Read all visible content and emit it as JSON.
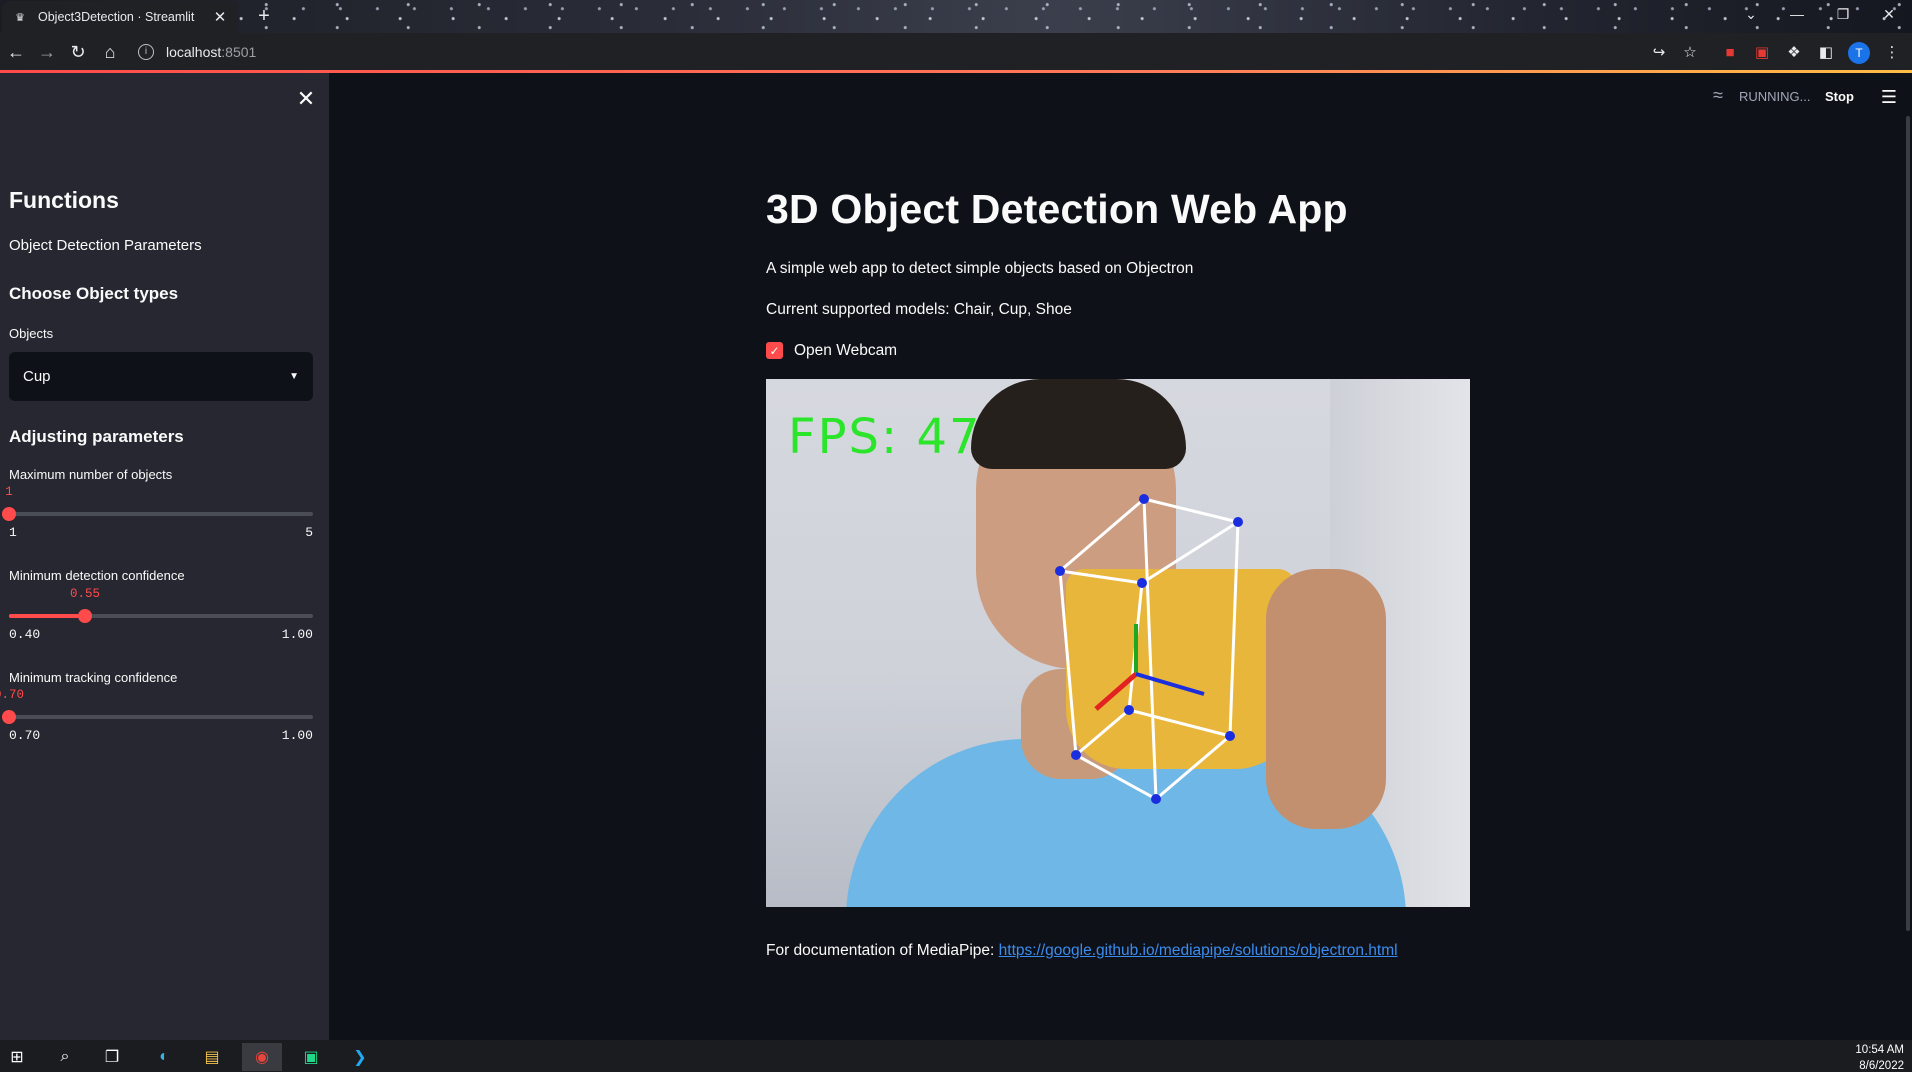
{
  "browser": {
    "tab_title": "Object3Detection · Streamlit",
    "url_host": "localhost",
    "url_port": ":8501",
    "profile_initial": "T"
  },
  "app": {
    "status": "RUNNING...",
    "stop_label": "Stop"
  },
  "sidebar": {
    "title": "Functions",
    "subtitle": "Object Detection Parameters",
    "section_objects": "Choose Object types",
    "objects_label": "Objects",
    "objects_value": "Cup",
    "section_params": "Adjusting parameters",
    "sliders": [
      {
        "label": "Maximum number of objects",
        "value": "1",
        "min": "1",
        "max": "5",
        "fraction": 0.0
      },
      {
        "label": "Minimum detection confidence",
        "value": "0.55",
        "min": "0.40",
        "max": "1.00",
        "fraction": 0.25
      },
      {
        "label": "Minimum tracking confidence",
        "value": "0.70",
        "min": "0.70",
        "max": "1.00",
        "fraction": 0.0
      }
    ]
  },
  "main": {
    "title": "3D Object Detection Web App",
    "description": "A simple web app to detect simple objects based on Objectron",
    "models": "Current supported models: Chair, Cup, Shoe",
    "webcam_label": "Open Webcam",
    "webcam_checked": true,
    "fps_overlay": "FPS: 47",
    "doc_prefix": "For documentation of MediaPipe:",
    "doc_link": "https://google.github.io/mediapipe/solutions/objectron.html"
  },
  "taskbar": {
    "time": "10:54 AM",
    "date": "8/6/2022"
  },
  "colors": {
    "accent": "#ff4b4b",
    "background": "#0e1117",
    "sidebar": "#262730",
    "link": "#3b8cf0"
  }
}
